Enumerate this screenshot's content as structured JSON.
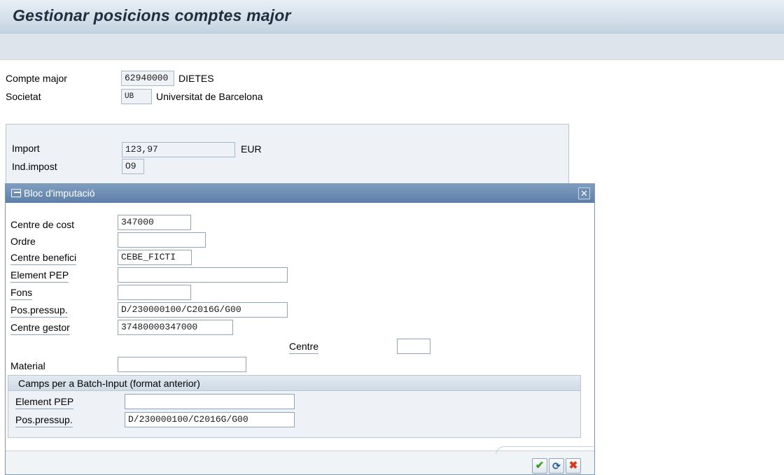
{
  "window": {
    "title": "Gestionar posicions comptes major"
  },
  "header_fields": {
    "gl_account": {
      "label": "Compte major",
      "value": "62940000",
      "description": "DIETES"
    },
    "company": {
      "label": "Societat",
      "value": "UB",
      "description": "Universitat de Barcelona"
    }
  },
  "amount_group": {
    "amount": {
      "label": "Import",
      "value": "123,97",
      "currency": "EUR"
    },
    "tax_code": {
      "label": "Ind.impost",
      "value": "O9"
    }
  },
  "dialog": {
    "title": "Bloc d'imputació",
    "close_icon": "close-icon",
    "fields": {
      "cost_center": {
        "label": "Centre de cost",
        "value": "347000"
      },
      "order": {
        "label": "Ordre",
        "value": ""
      },
      "profit_center": {
        "label": "Centre benefici",
        "value": "CEBE_FICTI"
      },
      "wbs_element": {
        "label": "Element PEP",
        "value": ""
      },
      "fund": {
        "label": "Fons",
        "value": ""
      },
      "commitment_item": {
        "label": "Pos.pressup.",
        "value": "D/230000100/C2016G/G00"
      },
      "funds_center": {
        "label": "Centre gestor",
        "value": "37480000347000"
      },
      "plant": {
        "label": "Centre",
        "value": ""
      },
      "material": {
        "label": "Material",
        "value": ""
      }
    },
    "batch_input": {
      "title": "Camps per a Batch-Input (format anterior)",
      "wbs_element": {
        "label": "Element PEP",
        "value": ""
      },
      "commitment_item": {
        "label": "Pos.pressup.",
        "value": "D/230000100/C2016G/G00"
      }
    },
    "buttons": {
      "confirm": {
        "icon": "checkmark-icon",
        "glyph": "✔"
      },
      "refresh": {
        "icon": "refresh-icon",
        "glyph": "⟳"
      },
      "cancel": {
        "icon": "cancel-icon",
        "glyph": "✖"
      }
    }
  },
  "colors": {
    "title_bar": "#d5e0ea",
    "dialog_header": "#5d7fa8",
    "confirm": "#3d9a25",
    "cancel": "#d23c1c"
  }
}
